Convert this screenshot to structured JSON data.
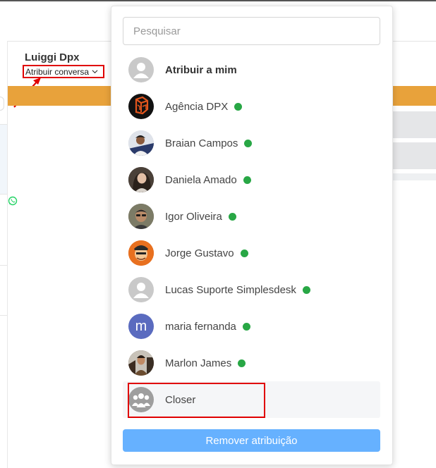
{
  "contact": {
    "name": "Luiggi Dpx"
  },
  "assign": {
    "trigger_label": "Atribuir conversa"
  },
  "dropdown": {
    "search_placeholder": "Pesquisar",
    "items": [
      {
        "label": "Atribuir a mim",
        "avatar": "default-user-avatar"
      },
      {
        "label": "Agência DPX",
        "avatar": "agencia-dpx-logo",
        "status": "online"
      },
      {
        "label": "Braian Campos",
        "avatar": "user-photo",
        "status": "online"
      },
      {
        "label": "Daniela Amado",
        "avatar": "user-photo",
        "status": "online"
      },
      {
        "label": "Igor Oliveira",
        "avatar": "user-photo",
        "status": "online"
      },
      {
        "label": "Jorge Gustavo",
        "avatar": "user-photo",
        "status": "online"
      },
      {
        "label": "Lucas Suporte Simplesdesk",
        "avatar": "default-user-avatar",
        "status": "online"
      },
      {
        "label": "maria fernanda",
        "avatar": "initial-avatar",
        "initial": "m",
        "status": "online"
      },
      {
        "label": "Marlon James",
        "avatar": "user-photo",
        "status": "online"
      },
      {
        "label": "Closer",
        "avatar": "team-group-avatar"
      }
    ],
    "remove_label": "Remover atribuição"
  },
  "colors": {
    "online": "#28a745",
    "accent_button": "#66b1ff",
    "orange_bar": "#e8a23b",
    "highlight_border": "#e00000",
    "initial_avatar": "#5a6bbf"
  }
}
